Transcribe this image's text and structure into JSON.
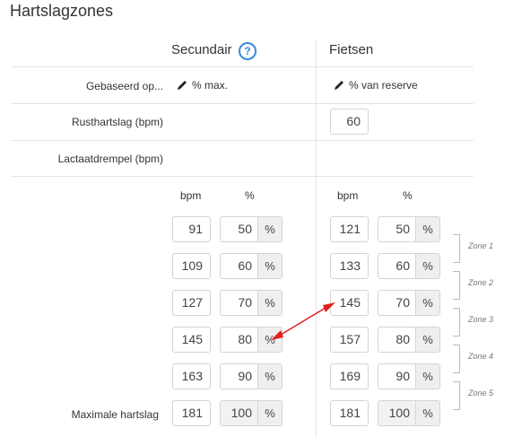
{
  "page_title": "Hartslagzones",
  "columns": {
    "secondary": {
      "label": "Secundair",
      "help_icon": "?"
    },
    "cycling": {
      "label": "Fietsen"
    }
  },
  "labels": {
    "based_on": "Gebaseerd op...",
    "resting_hr": "Rusthartslag (bpm)",
    "lactate_threshold": "Lactaatdrempel (bpm)",
    "max_hr": "Maximale hartslag",
    "bpm": "bpm",
    "percent": "%"
  },
  "secondary": {
    "based_on_value": "% max.",
    "zones": [
      {
        "bpm": "91",
        "pct": "50"
      },
      {
        "bpm": "109",
        "pct": "60"
      },
      {
        "bpm": "127",
        "pct": "70"
      },
      {
        "bpm": "145",
        "pct": "80"
      },
      {
        "bpm": "163",
        "pct": "90"
      }
    ],
    "max": {
      "bpm": "181",
      "pct": "100"
    }
  },
  "cycling": {
    "based_on_value": "% van reserve",
    "resting_hr": "60",
    "zones": [
      {
        "bpm": "121",
        "pct": "50"
      },
      {
        "bpm": "133",
        "pct": "60"
      },
      {
        "bpm": "145",
        "pct": "70"
      },
      {
        "bpm": "157",
        "pct": "80"
      },
      {
        "bpm": "169",
        "pct": "90"
      }
    ],
    "max": {
      "bpm": "181",
      "pct": "100"
    }
  },
  "unit": "%",
  "zone_labels": [
    "Zone 1",
    "Zone 2",
    "Zone 3",
    "Zone 4",
    "Zone 5"
  ],
  "colors": {
    "accent": "#3a8ad6",
    "arrow": "#e02020"
  }
}
